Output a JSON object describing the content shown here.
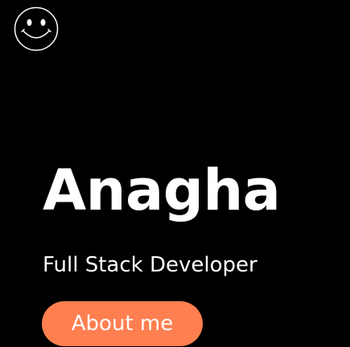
{
  "header": {
    "logo_icon": "smiley-face-icon"
  },
  "hero": {
    "name": "Anagha",
    "role": "Full Stack Developer",
    "cta_label": "About me"
  },
  "colors": {
    "background": "#000000",
    "text": "#ffffff",
    "accent": "#ff7f50"
  }
}
